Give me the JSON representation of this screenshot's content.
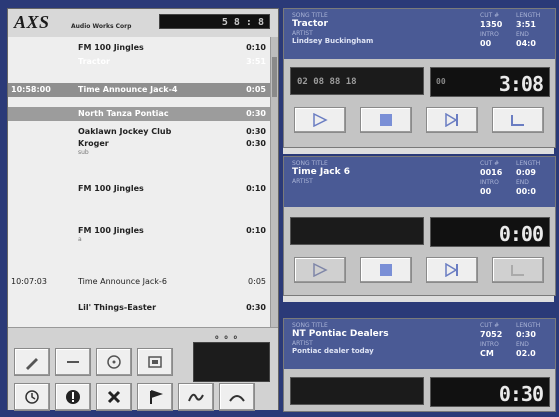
{
  "app": {
    "brand": "AXS",
    "brand_sub": "Audio Works Corp",
    "clock": "5 8 : 8"
  },
  "log": [
    {
      "time": "",
      "name": "FM 100 Jingles",
      "dur": "0:10",
      "style": "normal"
    },
    {
      "time": "",
      "name": "Tractor",
      "dur": "3:51",
      "style": "dim"
    },
    {
      "time": "10:58:00",
      "name": "Time Announce Jack-4",
      "dur": "0:05",
      "style": "hl"
    },
    {
      "time": "",
      "name": "North Tanza Pontiac",
      "dur": "0:30",
      "style": "hl2"
    },
    {
      "time": "",
      "name": "Oaklawn Jockey Club",
      "dur": "0:30",
      "style": "normal"
    },
    {
      "time": "",
      "name": "Kroger",
      "dur": "0:30",
      "style": "normal",
      "sub": "sub"
    },
    {
      "time": "",
      "name": "FM 100 Jingles",
      "dur": "0:10",
      "style": "normal"
    },
    {
      "time": "",
      "name": "FM 100 Jingles",
      "dur": "0:10",
      "style": "normal",
      "sub": "a"
    },
    {
      "time": "10:07:03",
      "name": "Time Announce Jack-6",
      "dur": "0:05",
      "style": "normal"
    },
    {
      "time": "",
      "name": "Lil' Things-Easter",
      "dur": "0:30",
      "style": "normal"
    }
  ],
  "small_display": {
    "dots": "o o o o"
  },
  "control_buttons": [
    {
      "icon": "pen-icon"
    },
    {
      "icon": "dash-icon"
    },
    {
      "icon": "cd-icon"
    },
    {
      "icon": "cart-icon"
    },
    {
      "icon": "clock-icon"
    },
    {
      "icon": "stop-circle-icon"
    },
    {
      "icon": "x-icon"
    },
    {
      "icon": "flag-icon"
    },
    {
      "icon": "wave-icon"
    },
    {
      "icon": "curve-icon"
    }
  ],
  "carts": [
    {
      "song_label": "SONG TITLE",
      "title": "Tractor",
      "artist_label": "ARTIST",
      "artist": "Lindsey Buckingham",
      "cart_label": "CUT #",
      "cart": "1350",
      "length_label": "LENGTH",
      "length": "3:51",
      "intro_label": "INTRO",
      "intro": "00",
      "end_label": "END",
      "end": "04:0",
      "left_display": "02  08  88  18",
      "right_small": "00",
      "right_big": "3:08"
    },
    {
      "song_label": "SONG TITLE",
      "title": "Time Jack 6",
      "artist_label": "ARTIST",
      "artist": "",
      "cart_label": "CUT #",
      "cart": "0016",
      "length_label": "LENGTH",
      "length": "0:09",
      "intro_label": "INTRO",
      "intro": "00",
      "end_label": "END",
      "end": "00:0",
      "left_display": "",
      "right_small": "",
      "right_big": "0:00"
    },
    {
      "song_label": "SONG TITLE",
      "title": "NT Pontiac Dealers",
      "artist_label": "ARTIST",
      "artist": "Pontiac dealer today",
      "cart_label": "CUT #",
      "cart": "7052",
      "length_label": "LENGTH",
      "length": "0:30",
      "intro_label": "INTRO",
      "intro": "CM",
      "end_label": "END",
      "end": "02.0",
      "left_display": "",
      "right_small": "",
      "right_big": "0:30"
    }
  ]
}
